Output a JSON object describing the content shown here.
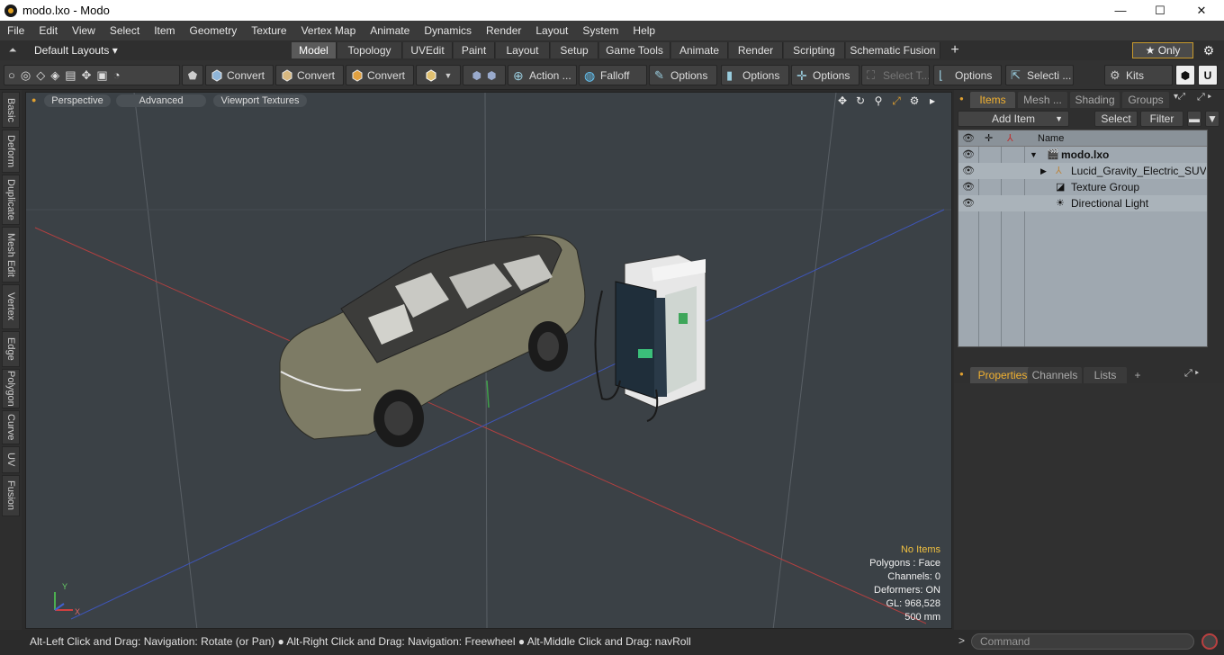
{
  "window": {
    "title": "modo.lxo - Modo",
    "controls": {
      "minimize": "—",
      "maximize": "☐",
      "close": "✕"
    }
  },
  "menu": [
    "File",
    "Edit",
    "View",
    "Select",
    "Item",
    "Geometry",
    "Texture",
    "Vertex Map",
    "Animate",
    "Dynamics",
    "Render",
    "Layout",
    "System",
    "Help"
  ],
  "layouts": {
    "label": "Default Layouts ▾",
    "tabs": [
      "Model",
      "Topology",
      "UVEdit",
      "Paint",
      "Layout",
      "Setup",
      "Game Tools",
      "Animate",
      "Render",
      "Scripting",
      "Schematic Fusion"
    ],
    "active": "Model",
    "add": "+",
    "only": "★  Only"
  },
  "toolbar": {
    "convert1": "Convert",
    "convert2": "Convert",
    "convert3": "Convert",
    "action": "Action  ...",
    "falloff": "Falloff",
    "options1": "Options",
    "options2": "Options",
    "options3": "Options",
    "select_t": "Select T...",
    "options4": "Options",
    "selecti": "Selecti ...",
    "kits": "Kits"
  },
  "left_tabs": [
    "Basic",
    "Deform",
    "Duplicate",
    "Mesh Edit",
    "Vertex",
    "Edge",
    "Polygon",
    "Curve",
    "UV",
    "Fusion"
  ],
  "viewport": {
    "perspective": "Perspective",
    "advanced": "Advanced",
    "textures": "Viewport Textures",
    "axis_y": "Y",
    "axis_x": "X",
    "stats": {
      "no_items": "No Items",
      "polygons": "Polygons : Face",
      "channels": "Channels: 0",
      "deformers": "Deformers: ON",
      "gl": "GL: 968,528",
      "scale": "500 mm"
    }
  },
  "items_panel": {
    "tabs": [
      "Items",
      "Mesh ...",
      "Shading",
      "Groups"
    ],
    "add_item": "Add Item",
    "select": "Select",
    "filter": "Filter",
    "name_col": "Name",
    "rows": [
      {
        "label": "modo.lxo"
      },
      {
        "label": "Lucid_Gravity_Electric_SUV_..."
      },
      {
        "label": "Texture Group"
      },
      {
        "label": "Directional Light"
      }
    ]
  },
  "properties_panel": {
    "tabs": [
      "Properties",
      "Channels",
      "Lists"
    ],
    "add": "+"
  },
  "status": {
    "hint": "Alt-Left Click and Drag: Navigation: Rotate (or Pan) ● Alt-Right Click and Drag: Navigation: Freewheel ● Alt-Middle Click and Drag: navRoll",
    "command_placeholder": "Command",
    "arrow": ">"
  }
}
